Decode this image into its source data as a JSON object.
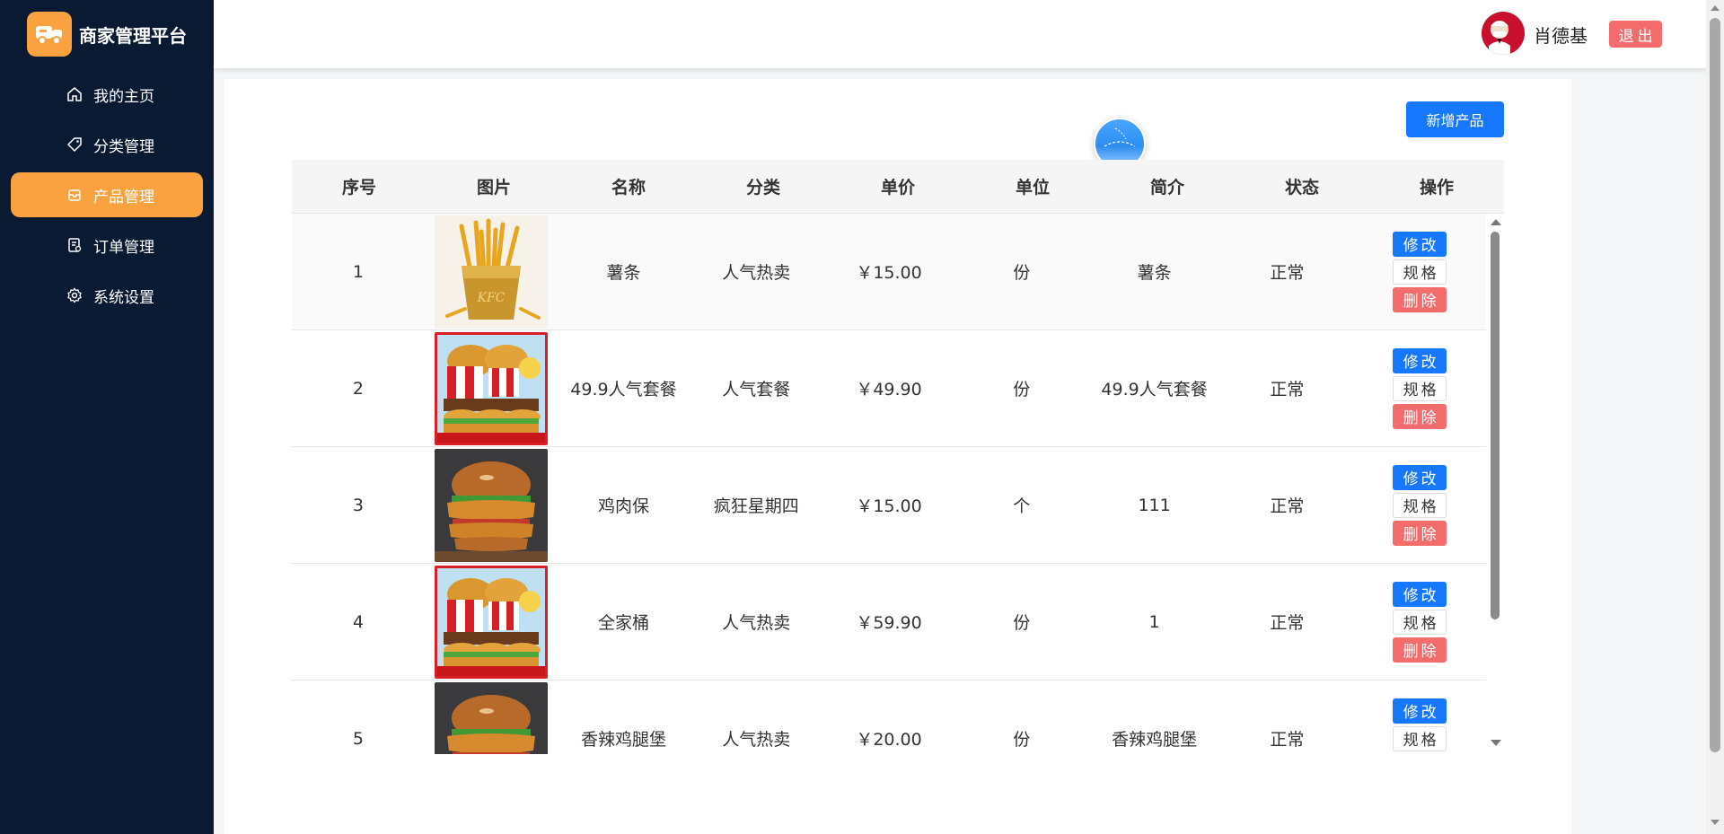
{
  "brand": {
    "title": "商家管理平台",
    "logo_icon": "truck-logo-icon",
    "accent": "#f9a23f"
  },
  "sidebar": {
    "items": [
      {
        "label": "我的主页",
        "icon": "home-icon",
        "active": false
      },
      {
        "label": "分类管理",
        "icon": "tag-icon",
        "active": false
      },
      {
        "label": "产品管理",
        "icon": "box-icon",
        "active": true
      },
      {
        "label": "订单管理",
        "icon": "order-icon",
        "active": false
      },
      {
        "label": "系统设置",
        "icon": "gear-icon",
        "active": false
      }
    ]
  },
  "header": {
    "username": "肖德基",
    "logout_label": "退出",
    "avatar_icon": "kfc-avatar"
  },
  "toolbar": {
    "add_label": "新增产品"
  },
  "table": {
    "columns": [
      "序号",
      "图片",
      "名称",
      "分类",
      "单价",
      "单位",
      "简介",
      "状态",
      "操作"
    ],
    "rows": [
      {
        "index": "1",
        "name": "薯条",
        "category": "人气热卖",
        "price": "￥15.00",
        "unit": "份",
        "intro": "薯条",
        "status": "正常",
        "image": "fries"
      },
      {
        "index": "2",
        "name": "49.9人气套餐",
        "category": "人气套餐",
        "price": "￥49.90",
        "unit": "份",
        "intro": "49.9人气套餐",
        "status": "正常",
        "image": "bucket"
      },
      {
        "index": "3",
        "name": "鸡肉保",
        "category": "疯狂星期四",
        "price": "￥15.00",
        "unit": "个",
        "intro": "111",
        "status": "正常",
        "image": "burger"
      },
      {
        "index": "4",
        "name": "全家桶",
        "category": "人气热卖",
        "price": "￥59.90",
        "unit": "份",
        "intro": "1",
        "status": "正常",
        "image": "bucket"
      },
      {
        "index": "5",
        "name": "香辣鸡腿堡",
        "category": "人气热卖",
        "price": "￥20.00",
        "unit": "份",
        "intro": "香辣鸡腿堡",
        "status": "正常",
        "image": "burger"
      }
    ],
    "actions": {
      "edit": "修改",
      "spec": "规格",
      "delete": "删除"
    }
  },
  "colors": {
    "sidebar_bg": "#0b1a33",
    "primary": "#1677ff",
    "danger": "#f56c6c"
  }
}
